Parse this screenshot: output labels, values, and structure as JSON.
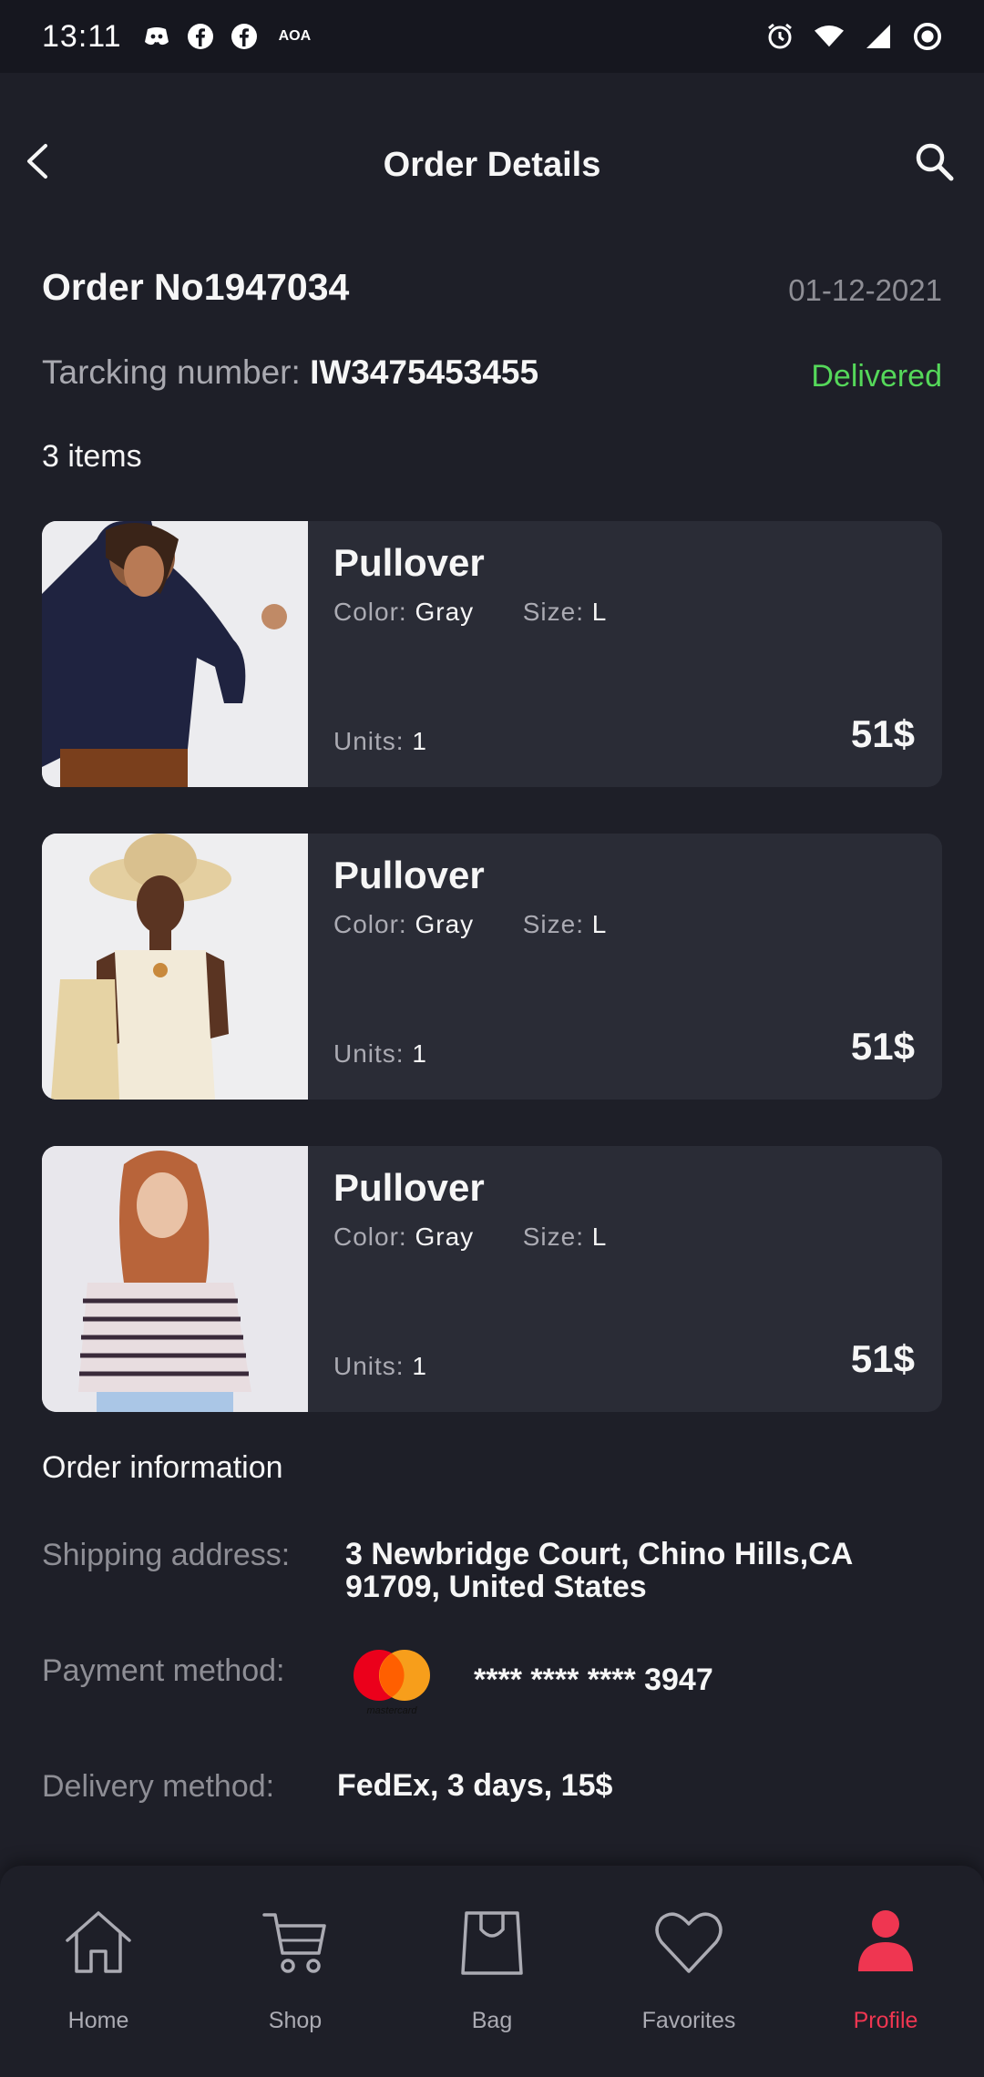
{
  "status_bar": {
    "time": "13:11",
    "carrier_text": "AOA",
    "icons": [
      "discord-icon",
      "facebook-icon",
      "facebook-icon",
      "alarm-icon",
      "wifi-icon",
      "signal-icon",
      "record-icon"
    ]
  },
  "header": {
    "title": "Order Details",
    "back_icon": "chevron-left-icon",
    "search_icon": "search-icon"
  },
  "order": {
    "number": "Order No1947034",
    "date": "01-12-2021",
    "tracking_label": "Tarcking number:",
    "tracking_number": "IW3475453455",
    "status": "Delivered",
    "items_count": "3 items"
  },
  "labels": {
    "color": "Color:",
    "size": "Size:",
    "units": "Units:"
  },
  "items": [
    {
      "title": "Pullover",
      "color": "Gray",
      "size": "L",
      "units": "1",
      "price": "51$"
    },
    {
      "title": "Pullover",
      "color": "Gray",
      "size": "L",
      "units": "1",
      "price": "51$"
    },
    {
      "title": "Pullover",
      "color": "Gray",
      "size": "L",
      "units": "1",
      "price": "51$"
    }
  ],
  "order_info": {
    "title": "Order information",
    "shipping_label": "Shipping address:",
    "shipping_line1": "3 Newbridge Court, Chino Hills,CA",
    "shipping_line2": "91709, United States",
    "payment_label": "Payment method:",
    "payment_brand_text": "mastercard",
    "card_number": "**** **** **** 3947",
    "delivery_label": "Delivery method:",
    "delivery_value": "FedEx, 3 days, 15$"
  },
  "bottom_nav": [
    {
      "label": "Home",
      "icon": "home-icon",
      "active": false
    },
    {
      "label": "Shop",
      "icon": "cart-icon",
      "active": false
    },
    {
      "label": "Bag",
      "icon": "bag-icon",
      "active": false
    },
    {
      "label": "Favorites",
      "icon": "heart-icon",
      "active": false
    },
    {
      "label": "Profile",
      "icon": "profile-icon",
      "active": true
    }
  ],
  "colors": {
    "background": "#1e1f28",
    "card": "#2a2c36",
    "accent": "#ef3651",
    "success": "#55d85a",
    "muted": "#8e8e95"
  }
}
